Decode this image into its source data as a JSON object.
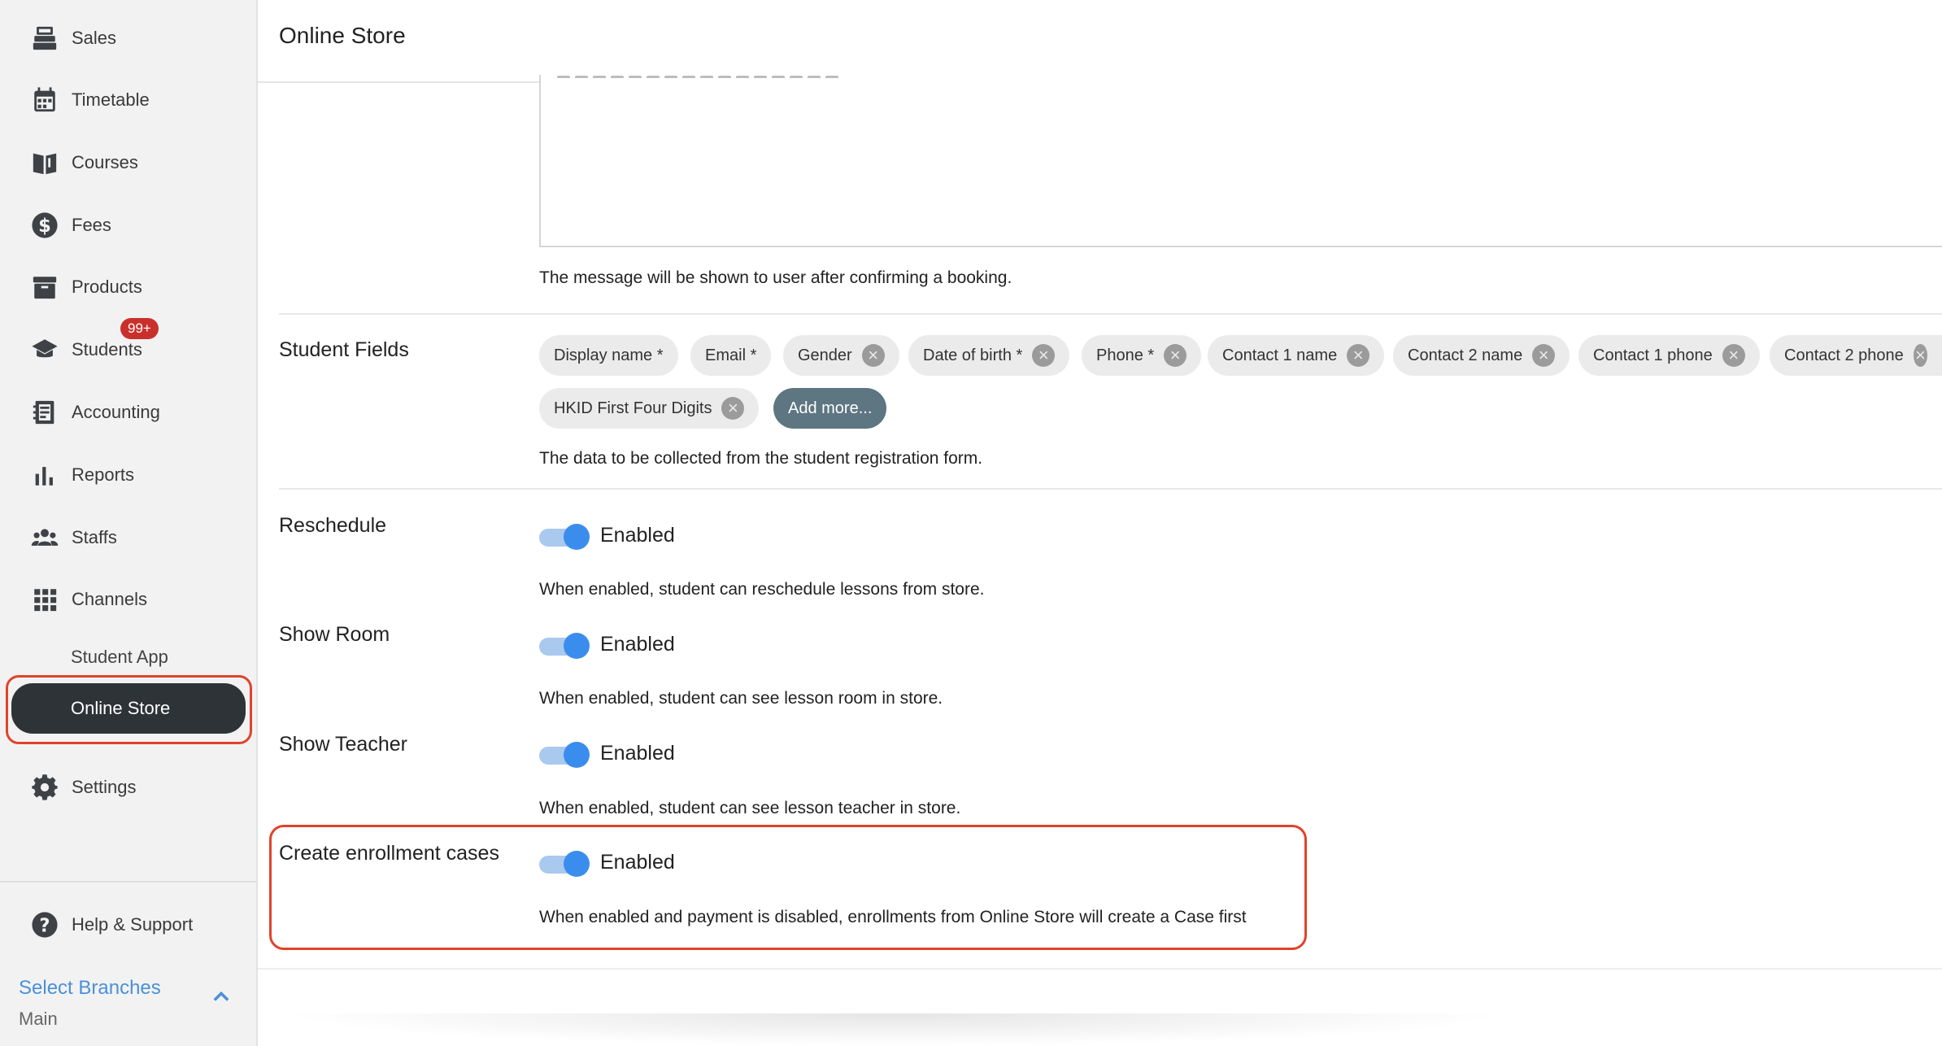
{
  "sidebar": {
    "items": [
      {
        "label": "Sales",
        "icon": "cash-register-icon"
      },
      {
        "label": "Timetable",
        "icon": "calendar-icon"
      },
      {
        "label": "Courses",
        "icon": "book-icon"
      },
      {
        "label": "Fees",
        "icon": "dollar-circle-icon"
      },
      {
        "label": "Products",
        "icon": "archive-box-icon"
      },
      {
        "label": "Students",
        "icon": "graduation-cap-icon",
        "badge": "99+"
      },
      {
        "label": "Accounting",
        "icon": "ledger-icon"
      },
      {
        "label": "Reports",
        "icon": "bar-chart-icon"
      },
      {
        "label": "Staffs",
        "icon": "people-icon"
      },
      {
        "label": "Channels",
        "icon": "grid-icon"
      }
    ],
    "channels_sub": {
      "student_app": "Student App",
      "online_store": "Online Store"
    },
    "settings": "Settings",
    "help": "Help & Support",
    "branches": {
      "link": "Select Branches",
      "value": "Main"
    }
  },
  "header": {
    "title": "Online Store"
  },
  "content": {
    "message_help": "The message will be shown to user after confirming a booking.",
    "student_fields": {
      "label": "Student Fields",
      "chips": [
        {
          "text": "Display name *",
          "removable": false
        },
        {
          "text": "Email *",
          "removable": false
        },
        {
          "text": "Gender",
          "removable": true
        },
        {
          "text": "Date of birth *",
          "removable": true
        },
        {
          "text": "Phone *",
          "removable": true
        },
        {
          "text": "Contact 1 name",
          "removable": true
        },
        {
          "text": "Contact 2 name",
          "removable": true
        },
        {
          "text": "Contact 1 phone",
          "removable": true
        },
        {
          "text": "Contact 2 phone",
          "removable": true
        },
        {
          "text": "HKID First Four Digits",
          "removable": true
        }
      ],
      "add_more": "Add more...",
      "help": "The data to be collected from the student registration form."
    },
    "reschedule": {
      "label": "Reschedule",
      "state": "Enabled",
      "enabled": true,
      "help": "When enabled, student can reschedule lessons from store."
    },
    "show_room": {
      "label": "Show Room",
      "state": "Enabled",
      "enabled": true,
      "help": "When enabled, student can see lesson room in store."
    },
    "show_teacher": {
      "label": "Show Teacher",
      "state": "Enabled",
      "enabled": true,
      "help": "When enabled, student can see lesson teacher in store."
    },
    "enrollment_cases": {
      "label": "Create enrollment cases",
      "state": "Enabled",
      "enabled": true,
      "help": "When enabled and payment is disabled, enrollments from Online Store will create a Case first"
    }
  },
  "colors": {
    "accent": "#3b8ded",
    "highlight": "#e0432b",
    "active_nav": "#2e3338",
    "badge": "#c9302c",
    "add_chip": "#5e7582"
  }
}
